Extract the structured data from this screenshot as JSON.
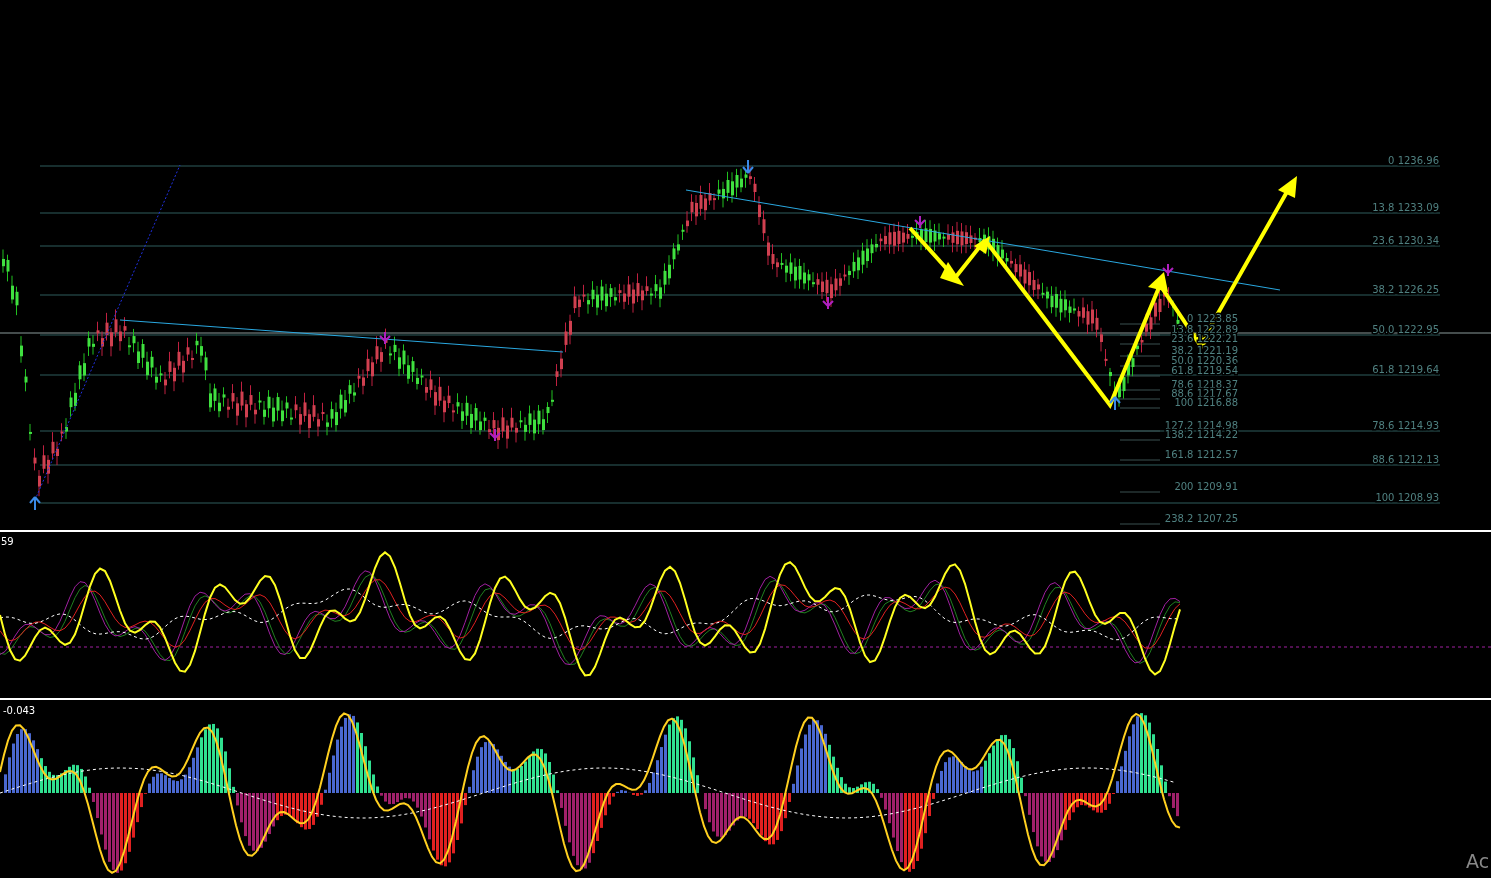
{
  "main_chart": {
    "fib_levels": [
      {
        "label": "0 1236.96"
      },
      {
        "label": "13.8 1233.09"
      },
      {
        "label": "23.6 1230.34"
      },
      {
        "label": "38.2 1226.25"
      },
      {
        "label": "50.0 1222.95"
      },
      {
        "label": "61.8 1219.64"
      },
      {
        "label": "78.6 1214.93"
      },
      {
        "label": "88.6 1212.13"
      },
      {
        "label": "100 1208.93"
      }
    ],
    "inner_fib_levels": [
      {
        "label": "0 1223.85"
      },
      {
        "label": "13.8 1222.89"
      },
      {
        "label": "23.6 1222.21"
      },
      {
        "label": "38.2 1221.19"
      },
      {
        "label": "50.0 1220.36"
      },
      {
        "label": "61.8 1219.54"
      },
      {
        "label": "78.6 1218.37"
      },
      {
        "label": "88.6 1217.67"
      },
      {
        "label": "100 1216.88"
      },
      {
        "label": "127.2 1214.98"
      },
      {
        "label": "138.2 1214.22"
      },
      {
        "label": "161.8 1212.57"
      },
      {
        "label": "200 1209.91"
      },
      {
        "label": "238.2 1207.25"
      }
    ]
  },
  "oscillator_panel": {
    "value": "59"
  },
  "histogram_panel": {
    "value": "-0.043"
  },
  "corner_text": "Ac"
}
